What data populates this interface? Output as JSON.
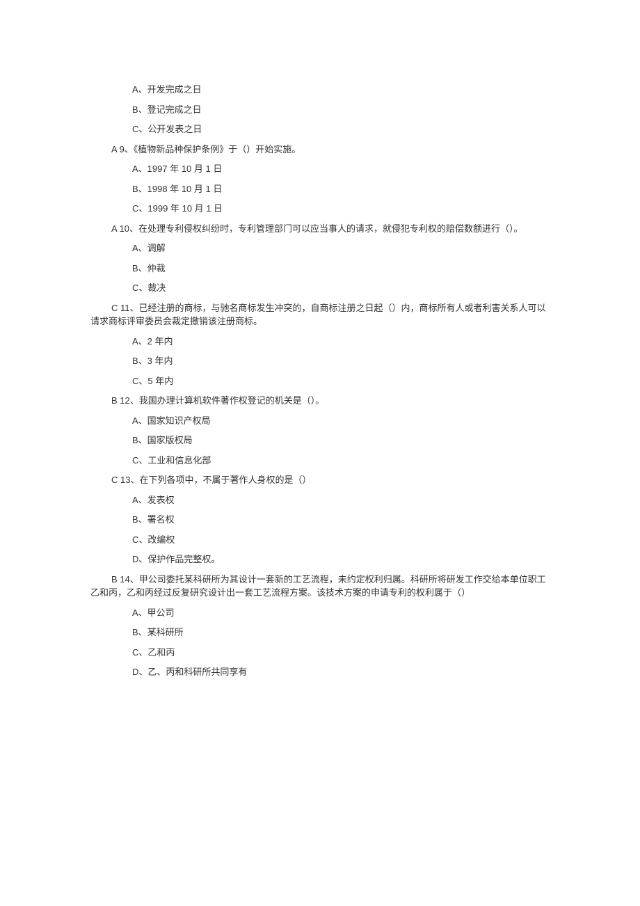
{
  "questions": [
    {
      "lead": "",
      "text": "",
      "options": [
        "A、开发完成之日",
        "B、登记完成之日",
        "C、公开发表之日"
      ]
    },
    {
      "lead": "A 9、",
      "text": "《植物新品种保护条例》于（）开始实施。",
      "options": [
        "A、1997 年 10 月 1 日",
        "B、1998 年 10 月 1 日",
        "C、1999 年 10 月 1 日"
      ]
    },
    {
      "lead": "A 10、",
      "text": "在处理专利侵权纠纷时，专利管理部门可以应当事人的请求，就侵犯专利权的赔偿数额进行（）。",
      "options": [
        "A、调解",
        "B、仲裁",
        "C、裁决"
      ]
    },
    {
      "lead": "C 11、",
      "text": "已经注册的商标，与驰名商标发生冲突的，自商标注册之日起（）内，商标所有人或者利害关系人可以请求商标评审委员会裁定撤销该注册商标。",
      "options": [
        "A、2 年内",
        "B、3 年内",
        "C、5 年内"
      ]
    },
    {
      "lead": "B 12、",
      "text": "我国办理计算机软件著作权登记的机关是（）。",
      "options": [
        "A、国家知识产权局",
        "B、国家版权局",
        "C、工业和信息化部"
      ]
    },
    {
      "lead": "C 13、",
      "text": "在下列各项中，不属于著作人身权的是（）",
      "options": [
        "A、发表权",
        "B、署名权",
        "C、改编权",
        "D、保护作品完整权。"
      ]
    },
    {
      "lead": "B 14、",
      "text": "甲公司委托某科研所为其设计一套新的工艺流程，未约定权利归属。科研所将研发工作交给本单位职工乙和丙，乙和丙经过反复研究设计出一套工艺流程方案。该技术方案的申请专利的权利属于（）",
      "options": [
        "A、甲公司",
        "B、某科研所",
        "C、乙和丙",
        "D、乙、丙和科研所共同享有"
      ]
    }
  ]
}
